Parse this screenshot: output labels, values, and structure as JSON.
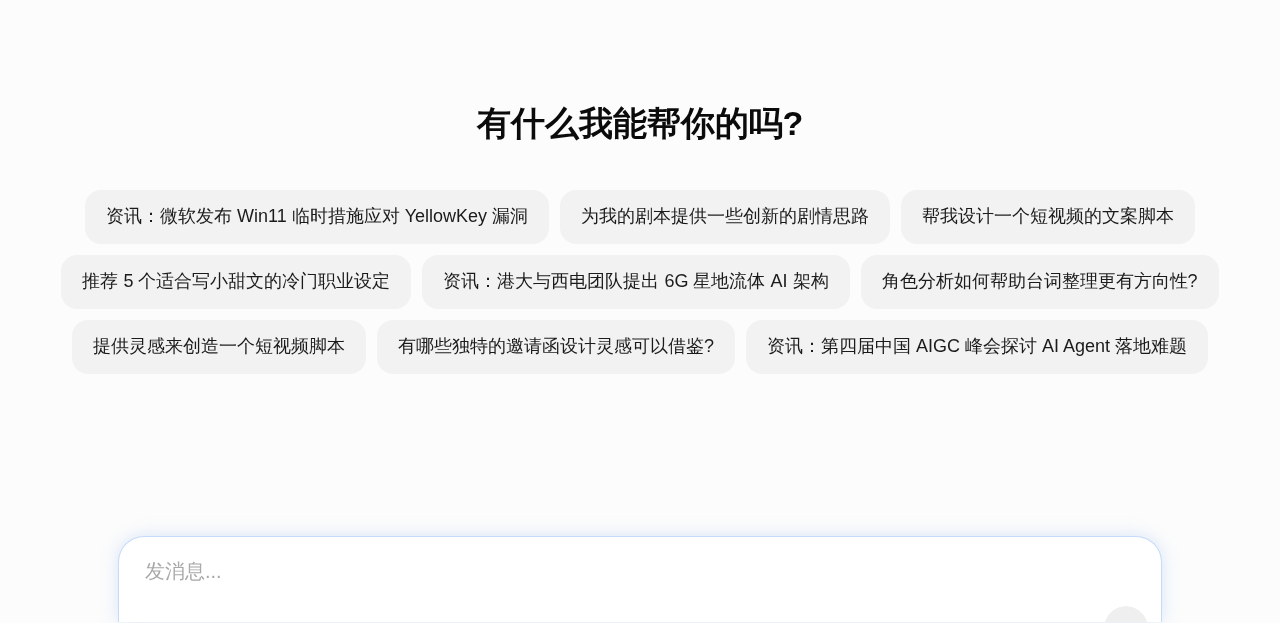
{
  "heading": "有什么我能帮你的吗?",
  "suggestions": [
    "资讯：微软发布 Win11 临时措施应对 YellowKey 漏洞",
    "为我的剧本提供一些创新的剧情思路",
    "帮我设计一个短视频的文案脚本",
    "推荐 5 个适合写小甜文的冷门职业设定",
    "资讯：港大与西电团队提出 6G 星地流体 AI 架构",
    "角色分析如何帮助台词整理更有方向性?",
    "提供灵感来创造一个短视频脚本",
    "有哪些独特的邀请函设计灵感可以借鉴?",
    "资讯：第四届中国 AIGC 峰会探讨 AI Agent 落地难题"
  ],
  "composer": {
    "placeholder": "发消息..."
  }
}
